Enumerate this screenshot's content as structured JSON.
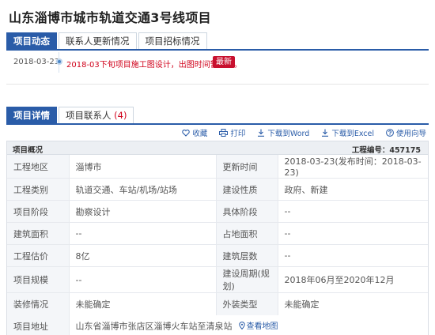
{
  "page_title": "山东淄博市城市轨道交通3号线项目",
  "tabs_top": [
    {
      "label": "项目动态",
      "active": true
    },
    {
      "label": "联系人更新情况",
      "active": false
    },
    {
      "label": "项目招标情况",
      "active": false
    }
  ],
  "updates": [
    {
      "date": "2018-03-23",
      "text": "2018-03下旬项目施工图设计，出图时间暂未定。",
      "badge": "最新"
    }
  ],
  "tabs_detail": [
    {
      "label": "项目详情",
      "active": true
    },
    {
      "label": "项目联系人",
      "count": "(4)",
      "active": false
    }
  ],
  "actions": [
    {
      "label": "收藏",
      "icon": "heart-icon"
    },
    {
      "label": "打印",
      "icon": "printer-icon"
    },
    {
      "label": "下载到Word",
      "icon": "download-icon"
    },
    {
      "label": "下载到Excel",
      "icon": "download-icon"
    },
    {
      "label": "使用向导",
      "icon": "help-icon"
    }
  ],
  "overview": {
    "title": "项目概况",
    "code_label": "工程编号：",
    "code_value": "457175"
  },
  "rows": [
    {
      "k1": "工程地区",
      "v1": "淄博市",
      "k2": "更新时间",
      "v2": "2018-03-23(发布时间：2018-03-23)"
    },
    {
      "k1": "工程类别",
      "v1": "轨道交通、车站/机场/站场",
      "k2": "建设性质",
      "v2": "政府、新建"
    },
    {
      "k1": "项目阶段",
      "v1": "勘察设计",
      "k2": "具体阶段",
      "v2": "--"
    },
    {
      "k1": "建筑面积",
      "v1": "--",
      "k2": "占地面积",
      "v2": "--"
    },
    {
      "k1": "工程估价",
      "v1": "8亿",
      "k2": "建筑层数",
      "v2": "--"
    },
    {
      "k1": "项目规模",
      "v1": "--",
      "k2": "建设周期(规划)",
      "v2": "2018年06月至2020年12月"
    },
    {
      "k1": "装修情况",
      "v1": "未能确定",
      "k2": "外装类型",
      "v2": "未能确定"
    }
  ],
  "address": {
    "label": "项目地址",
    "value": "山东省淄博市张店区淄博火车站至清泉站",
    "map_link": "查看地图"
  },
  "colors": {
    "primary": "#2a5ca8",
    "alert": "#d0021b",
    "badge": "#c8102e"
  }
}
